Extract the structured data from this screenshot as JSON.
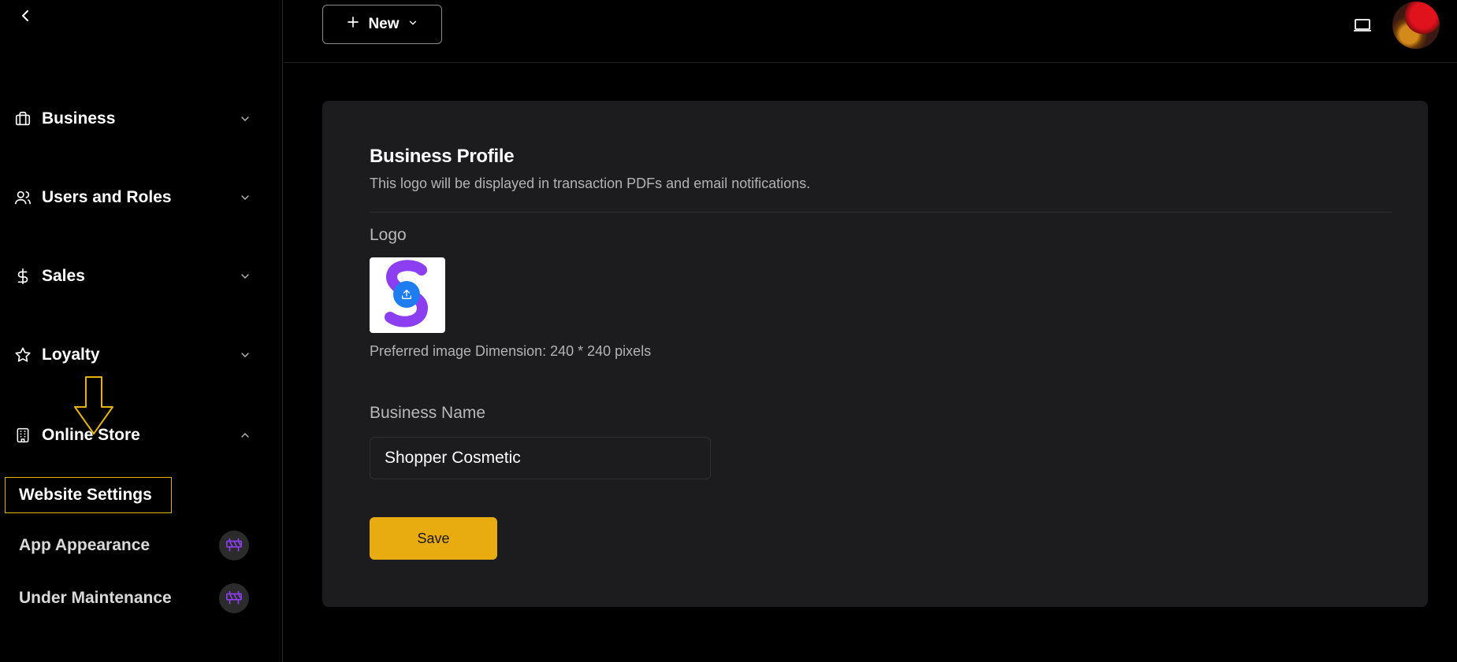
{
  "sidebar": {
    "items": [
      {
        "label": "Business",
        "icon": "briefcase-icon"
      },
      {
        "label": "Users and Roles",
        "icon": "users-icon"
      },
      {
        "label": "Sales",
        "icon": "dollar-icon"
      },
      {
        "label": "Loyalty",
        "icon": "star-icon"
      },
      {
        "label": "Online Store",
        "icon": "building-icon"
      }
    ],
    "sub_items": [
      {
        "label": "Website Settings"
      },
      {
        "label": "App Appearance",
        "badge": "under-construction-icon"
      },
      {
        "label": "Under Maintenance",
        "badge": "under-construction-icon"
      }
    ]
  },
  "topbar": {
    "new_label": "New"
  },
  "profile": {
    "title": "Business Profile",
    "subtitle": "This logo will be displayed in transaction PDFs and email notifications.",
    "logo_label": "Logo",
    "dimension_note": "Preferred image Dimension: 240 * 240 pixels",
    "name_label": "Business Name",
    "name_value": "Shopper Cosmetic",
    "save_label": "Save"
  },
  "colors": {
    "accent": "#e8ab10",
    "annotation": "#e5b20e",
    "upload": "#1e7df0",
    "logo_purple": "#8b3ff0"
  }
}
